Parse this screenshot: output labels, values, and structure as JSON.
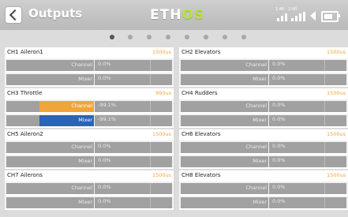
{
  "header": {
    "title": "Outputs",
    "logo_main": "ETH",
    "logo_accent": "OS",
    "back_icon": "chevron-left-icon"
  },
  "status": {
    "small_label_1": "1:40",
    "small_label_2": "2:00"
  },
  "pager": {
    "total": 8,
    "active_index": 0
  },
  "panels": [
    {
      "name": "CH1  Aileron1",
      "value": "1500us",
      "channel_label": "Channel",
      "channel_value": "0.0%",
      "mixer_label": "Mixer",
      "mixer_value": "0.0%"
    },
    {
      "name": "CH2  Elevators",
      "value": "1500us",
      "channel_label": "Channel",
      "channel_value": "0.0%",
      "mixer_label": "Mixer",
      "mixer_value": "0.0%"
    },
    {
      "name": "CH3  Throttle",
      "value": "993us",
      "channel_label": "Channel",
      "channel_value": "-99.1%",
      "mixer_label": "Mixer",
      "mixer_value": "-99.1%"
    },
    {
      "name": "CH4  Rudders",
      "value": "1500us",
      "channel_label": "Channel",
      "channel_value": "0.0%",
      "mixer_label": "Mixer",
      "mixer_value": "0.0%"
    },
    {
      "name": "CH5  Aileron2",
      "value": "1500us",
      "channel_label": "Channel",
      "channel_value": "0.0%",
      "mixer_label": "Mixer",
      "mixer_value": "0.0%"
    },
    {
      "name": "CH6  Elevators",
      "value": "1500us",
      "channel_label": "Channel",
      "channel_value": "0.0%",
      "mixer_label": "Mixer",
      "mixer_value": "0.0%"
    },
    {
      "name": "CH7  Ailerons",
      "value": "1500us",
      "channel_label": "Channel",
      "channel_value": "0.0%",
      "mixer_label": "Mixer",
      "mixer_value": "0.0%"
    },
    {
      "name": "CH8  Elevators",
      "value": "1500us",
      "channel_label": "Channel",
      "channel_value": "0.0%",
      "mixer_label": "Mixer",
      "mixer_value": "0.0%"
    }
  ],
  "colors": {
    "orange": "#f0a53a",
    "blue": "#2a63b8",
    "gray": "#a1a1a1"
  }
}
